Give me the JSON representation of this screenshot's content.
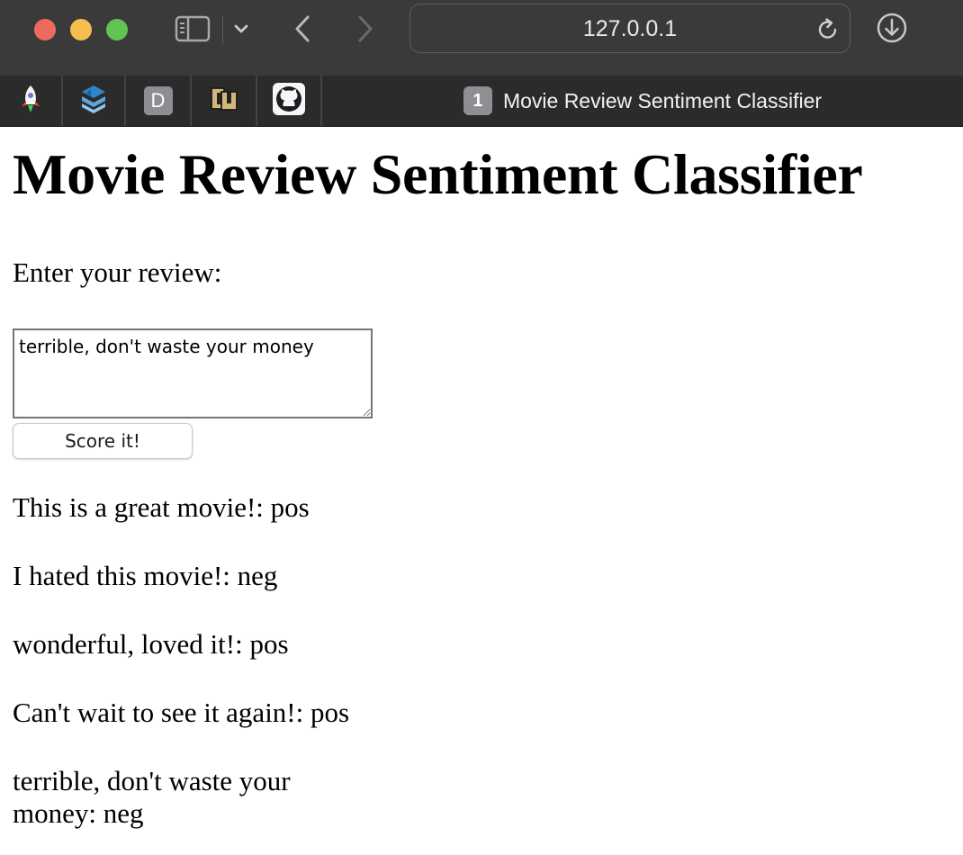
{
  "browser": {
    "url": "127.0.0.1",
    "tab_count": "1",
    "tab_title": "Movie Review Sentiment Classifier",
    "pinned_tabs": [
      {
        "icon": "rocket-icon"
      },
      {
        "icon": "stacked-layers-icon"
      },
      {
        "icon": "d-badge-icon",
        "label": "D"
      },
      {
        "icon": "cu-logo-icon"
      },
      {
        "icon": "github-icon"
      }
    ]
  },
  "page": {
    "title": "Movie Review Sentiment Classifier",
    "prompt_label": "Enter your review:",
    "review_value": "terrible, don't waste your money",
    "submit_label": "Score it!",
    "results": [
      "This is a great movie!: pos",
      "I hated this movie!: neg",
      "wonderful, loved it!: pos",
      "Can't wait to see it again!: pos",
      "terrible, don't waste your money: neg"
    ]
  }
}
